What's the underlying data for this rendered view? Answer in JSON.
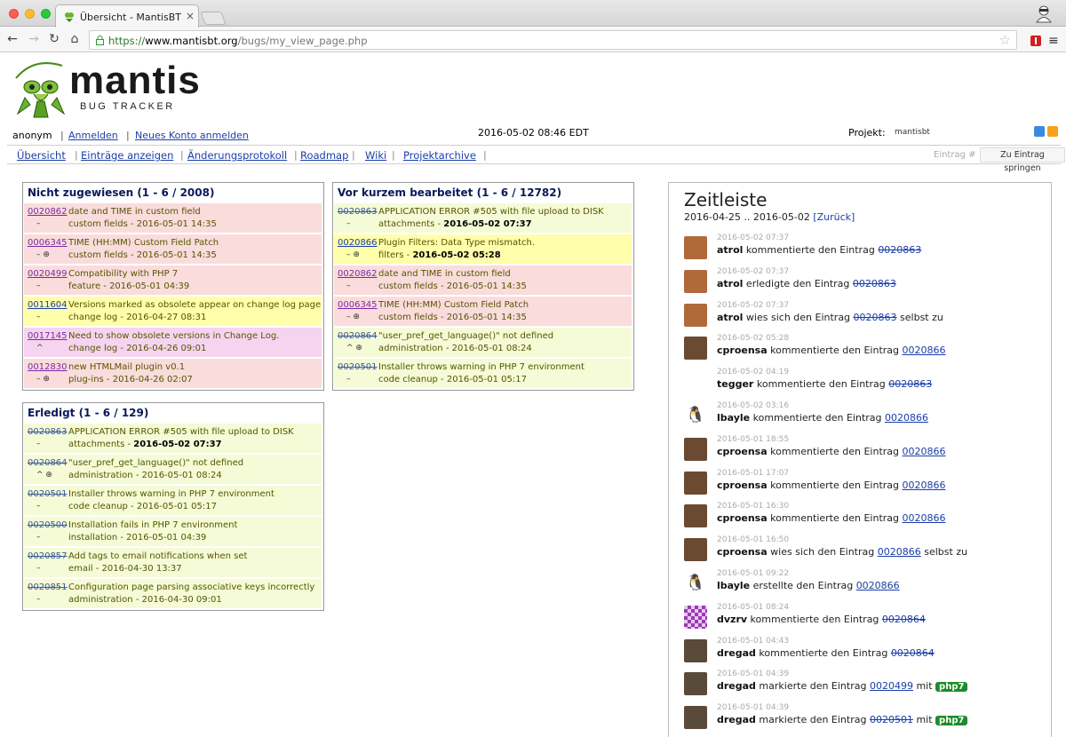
{
  "browser": {
    "tab_title": "Übersicht - MantisBT",
    "url_scheme": "https://",
    "url_domain": "www.mantisbt.org",
    "url_path": "/bugs/my_view_page.php"
  },
  "header": {
    "logo_text": "mantis",
    "logo_sub": "BUG TRACKER",
    "user": "anonym",
    "login_link": "Anmelden",
    "signup_link": "Neues Konto anmelden",
    "datetime": "2016-05-02 08:46 EDT",
    "project_label": "Projekt:",
    "project_value": "mantisbt"
  },
  "menu": {
    "items": [
      "Übersicht",
      "Einträge anzeigen",
      "Änderungsprotokoll",
      "Roadmap",
      "Wiki",
      "Projektarchive"
    ],
    "jump_label": "Eintrag #",
    "jump_button": "Zu Eintrag springen"
  },
  "unassigned": {
    "title": "Nicht zugewiesen (1 - 6 / 2008)",
    "rows": [
      {
        "id": "0020862",
        "mark": "–",
        "summary": "date and TIME in custom field",
        "meta": "custom fields - 2016-05-01 14:35"
      },
      {
        "id": "0006345",
        "mark": "– ⊕",
        "summary": "TIME (HH:MM) Custom Field Patch",
        "meta": "custom fields - 2016-05-01 14:35"
      },
      {
        "id": "0020499",
        "mark": "–",
        "summary": "Compatibility with PHP 7",
        "meta": "feature - 2016-05-01 04:39"
      },
      {
        "id": "0011604",
        "mark": "–",
        "summary": "Versions marked as obsolete appear on change log page",
        "meta": "change log - 2016-04-27 08:31"
      },
      {
        "id": "0017145",
        "mark": "^",
        "summary": "Need to show obsolete versions in Change Log.",
        "meta": "change log - 2016-04-26 09:01"
      },
      {
        "id": "0012830",
        "mark": "– ⊕",
        "summary": "new HTMLMail plugin v0.1",
        "meta": "plug-ins - 2016-04-26 02:07"
      }
    ]
  },
  "recent": {
    "title": "Vor kurzem bearbeitet (1 - 6 / 12782)",
    "rows": [
      {
        "id": "0020863",
        "mark": "–",
        "summary": "APPLICATION ERROR #505 with file upload to DISK",
        "meta_prefix": "attachments - ",
        "meta_bold": "2016-05-02 07:37"
      },
      {
        "id": "0020866",
        "mark": "– ⊕",
        "summary": "Plugin Filters: Data Type mismatch.",
        "meta_prefix": "filters - ",
        "meta_bold": "2016-05-02 05:28"
      },
      {
        "id": "0020862",
        "mark": "–",
        "summary": "date and TIME in custom field",
        "meta_prefix": "custom fields - 2016-05-01 14:35",
        "meta_bold": ""
      },
      {
        "id": "0006345",
        "mark": "– ⊕",
        "summary": "TIME (HH:MM) Custom Field Patch",
        "meta_prefix": "custom fields - 2016-05-01 14:35",
        "meta_bold": ""
      },
      {
        "id": "0020864",
        "mark": "^ ⊕",
        "summary": "\"user_pref_get_language()\" not defined",
        "meta_prefix": "administration - 2016-05-01 08:24",
        "meta_bold": ""
      },
      {
        "id": "0020501",
        "mark": "–",
        "summary": "Installer throws warning in PHP 7 environment",
        "meta_prefix": "code cleanup - 2016-05-01 05:17",
        "meta_bold": ""
      }
    ]
  },
  "resolved": {
    "title": "Erledigt (1 - 6 / 129)",
    "rows": [
      {
        "id": "0020863",
        "mark": "–",
        "summary": "APPLICATION ERROR #505 with file upload to DISK",
        "meta_prefix": "attachments - ",
        "meta_bold": "2016-05-02 07:37"
      },
      {
        "id": "0020864",
        "mark": "^ ⊕",
        "summary": "\"user_pref_get_language()\" not defined",
        "meta_prefix": "administration - 2016-05-01 08:24",
        "meta_bold": ""
      },
      {
        "id": "0020501",
        "mark": "–",
        "summary": "Installer throws warning in PHP 7 environment",
        "meta_prefix": "code cleanup - 2016-05-01 05:17",
        "meta_bold": ""
      },
      {
        "id": "0020500",
        "mark": "–",
        "summary": "Installation fails in PHP 7 environment",
        "meta_prefix": "installation - 2016-05-01 04:39",
        "meta_bold": ""
      },
      {
        "id": "0020857",
        "mark": "–",
        "summary": "Add tags to email notifications when set",
        "meta_prefix": "email - 2016-04-30 13:37",
        "meta_bold": ""
      },
      {
        "id": "0020851",
        "mark": "–",
        "summary": "Configuration page parsing associative keys incorrectly",
        "meta_prefix": "administration - 2016-04-30 09:01",
        "meta_bold": ""
      }
    ]
  },
  "timeline": {
    "title": "Zeitleiste",
    "range": "2016-04-25 .. 2016-05-02",
    "back_link": "[Zurück]",
    "entries": [
      {
        "date": "2016-05-02 07:37",
        "user": "atrol",
        "verb": "kommentierte den Eintrag",
        "issue": "0020863",
        "strike": true,
        "suffix": "",
        "tag": ""
      },
      {
        "date": "2016-05-02 07:37",
        "user": "atrol",
        "verb": "erledigte den Eintrag",
        "issue": "0020863",
        "strike": true,
        "suffix": "",
        "tag": ""
      },
      {
        "date": "2016-05-02 07:37",
        "user": "atrol",
        "verb": "wies sich den Eintrag",
        "issue": "0020863",
        "strike": true,
        "suffix": "selbst zu",
        "tag": ""
      },
      {
        "date": "2016-05-02 05:28",
        "user": "cproensa",
        "verb": "kommentierte den Eintrag",
        "issue": "0020866",
        "strike": false,
        "suffix": "",
        "tag": ""
      },
      {
        "date": "2016-05-02 04:19",
        "user": "tegger",
        "verb": "kommentierte den Eintrag",
        "issue": "0020863",
        "strike": true,
        "suffix": "",
        "tag": ""
      },
      {
        "date": "2016-05-02 03:16",
        "user": "lbayle",
        "verb": "kommentierte den Eintrag",
        "issue": "0020866",
        "strike": false,
        "suffix": "",
        "tag": ""
      },
      {
        "date": "2016-05-01 18:55",
        "user": "cproensa",
        "verb": "kommentierte den Eintrag",
        "issue": "0020866",
        "strike": false,
        "suffix": "",
        "tag": ""
      },
      {
        "date": "2016-05-01 17:07",
        "user": "cproensa",
        "verb": "kommentierte den Eintrag",
        "issue": "0020866",
        "strike": false,
        "suffix": "",
        "tag": ""
      },
      {
        "date": "2016-05-01 16:30",
        "user": "cproensa",
        "verb": "kommentierte den Eintrag",
        "issue": "0020866",
        "strike": false,
        "suffix": "",
        "tag": ""
      },
      {
        "date": "2016-05-01 16:50",
        "user": "cproensa",
        "verb": "wies sich den Eintrag",
        "issue": "0020866",
        "strike": false,
        "suffix": "selbst zu",
        "tag": ""
      },
      {
        "date": "2016-05-01 09:22",
        "user": "lbayle",
        "verb": "erstellte den Eintrag",
        "issue": "0020866",
        "strike": false,
        "suffix": "",
        "tag": ""
      },
      {
        "date": "2016-05-01 08:24",
        "user": "dvzrv",
        "verb": "kommentierte den Eintrag",
        "issue": "0020864",
        "strike": true,
        "suffix": "",
        "tag": ""
      },
      {
        "date": "2016-05-01 04:43",
        "user": "dregad",
        "verb": "kommentierte den Eintrag",
        "issue": "0020864",
        "strike": true,
        "suffix": "",
        "tag": ""
      },
      {
        "date": "2016-05-01 04:39",
        "user": "dregad",
        "verb": "markierte den Eintrag",
        "issue": "0020499",
        "strike": false,
        "suffix": "mit",
        "tag": "php7"
      },
      {
        "date": "2016-05-01 04:39",
        "user": "dregad",
        "verb": "markierte den Eintrag",
        "issue": "0020501",
        "strike": true,
        "suffix": "mit",
        "tag": "php7"
      }
    ]
  }
}
